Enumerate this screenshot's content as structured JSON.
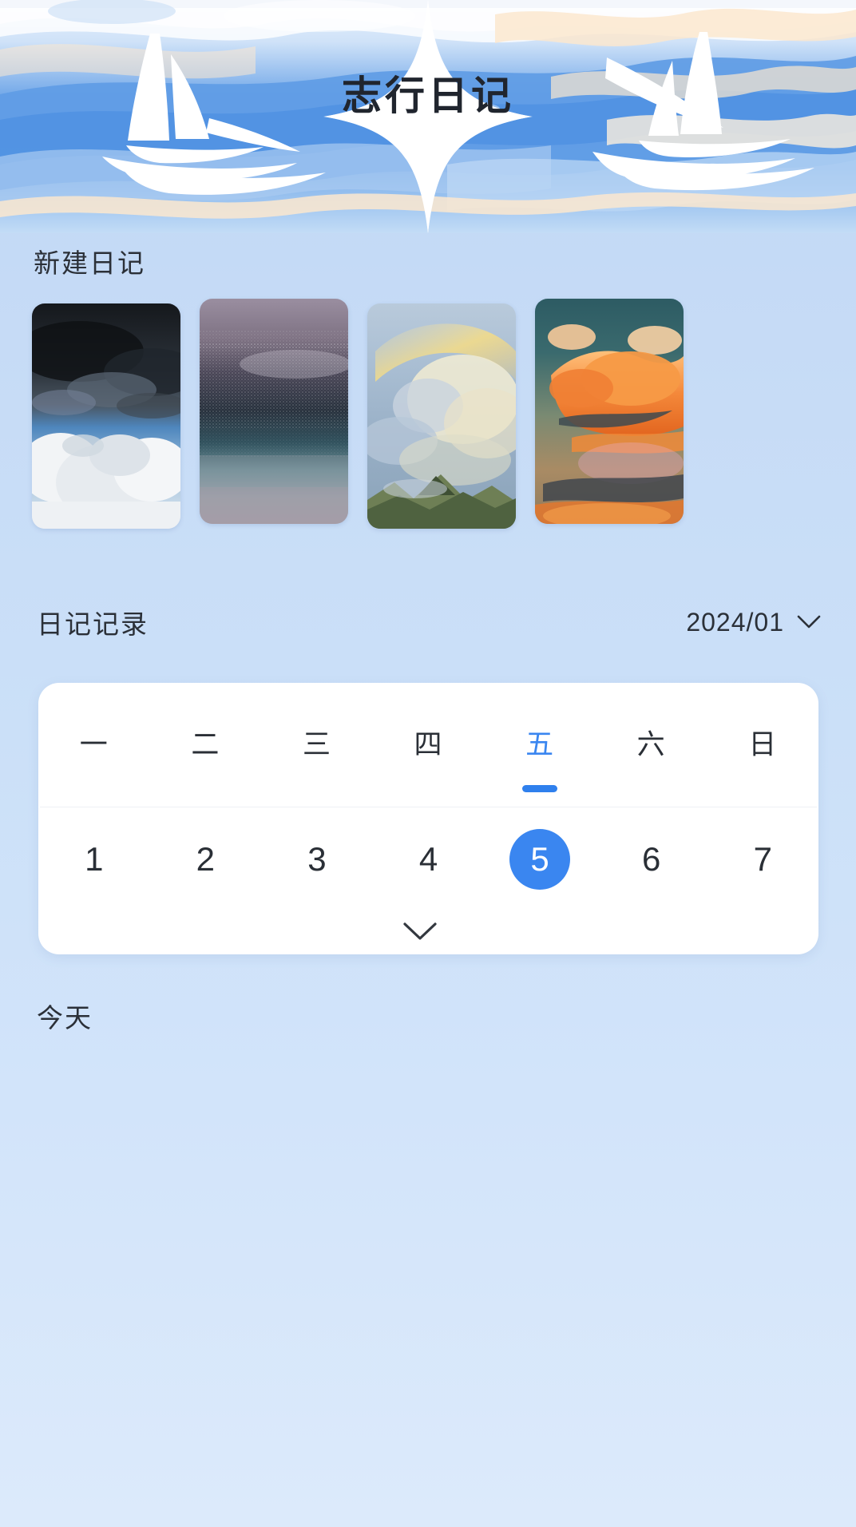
{
  "app": {
    "title": "志行日记"
  },
  "sections": {
    "new_diary_label": "新建日记",
    "records_label": "日记记录",
    "today_label": "今天"
  },
  "date_picker": {
    "value": "2024/01",
    "chevron": "chevron-down-icon"
  },
  "thumbnails": [
    {
      "name": "storm-clouds-over-cumulus",
      "alt": "暗云与积云"
    },
    {
      "name": "grainy-purple-teal-water",
      "alt": "颗粒紫青水面"
    },
    {
      "name": "rainbow-over-mountains",
      "alt": "山脉彩虹"
    },
    {
      "name": "orange-sunset-clouds",
      "alt": "橙色晚霞"
    }
  ],
  "calendar": {
    "weekdays": [
      "一",
      "二",
      "三",
      "四",
      "五",
      "六",
      "日"
    ],
    "active_weekday_index": 4,
    "days": [
      "1",
      "2",
      "3",
      "4",
      "5",
      "6",
      "7"
    ],
    "selected_day_index": 4,
    "expand_icon": "chevron-down-icon"
  },
  "colors": {
    "accent": "#3a86f0",
    "accent_bar": "#2f80ed",
    "text": "#2a2f36",
    "card": "#ffffff",
    "background_top": "#bfd7f4",
    "background_bottom": "#dceafb",
    "banner_blue": "#6ba4e7",
    "banner_cream": "#fbe8cf"
  }
}
